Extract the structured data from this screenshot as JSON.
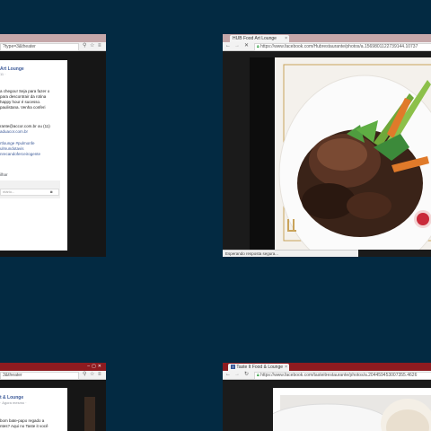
{
  "windows": [
    {
      "id": "w1",
      "url": "?type=3&theater",
      "page_name": "Art Lounge",
      "meta": "11 ·",
      "post_text": [
        "a chegou! Seja para fazer o",
        "para descontrair da rotina",
        "happy hour é sucesso.",
        "paulistana. Venha conferi"
      ],
      "contact": [
        "rante@accor.com.br ou (11)",
        "aduacor.com.br"
      ],
      "hashtags": [
        "rtlounge #pulmonfe",
        "ulmundotavis",
        "nrecandoferceirogente"
      ],
      "action": "ilhar",
      "comment_placeholder": "ntário..."
    },
    {
      "id": "w2",
      "tab_title": "HUB Food Art Lounge",
      "url": "https://www.facebook.com/Hubrestaurante/photos/a.1569801122739144.10737",
      "status": "Esperando resposta segura..."
    },
    {
      "id": "w3",
      "url": "3&theater",
      "page_name": "t & Lounge",
      "meta": "· Agora mesmo ·",
      "post_text": [
        "bom bate-papo regado a",
        "ntes? Aqui no Taste it você"
      ]
    },
    {
      "id": "w4",
      "tab_title": "Taste It Food & Lounge",
      "url": "https://www.facebook.com/tasteitrestaurante/photos/a.204459453007355.4626"
    }
  ],
  "colors": {
    "desktop": "#032a42",
    "tabbar_light": "#c5a7a9",
    "tabbar_dark": "#8e1b20",
    "fb_blue": "#3b5998"
  },
  "icons": {
    "back": "arrow-left-icon",
    "forward": "arrow-right-icon",
    "stop": "close-icon",
    "reload": "reload-icon",
    "lock": "lock-icon",
    "star": "star-icon",
    "menu": "hamburger-menu-icon",
    "search": "search-icon",
    "camera": "camera-icon"
  }
}
